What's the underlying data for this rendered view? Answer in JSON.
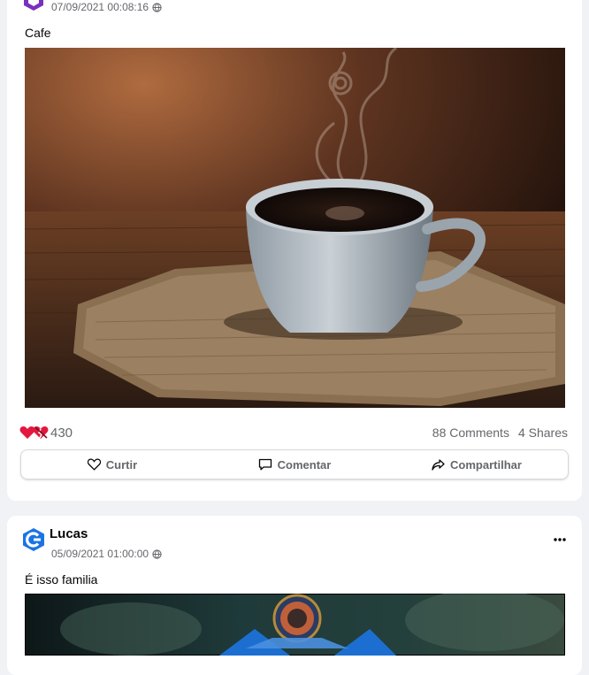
{
  "post1": {
    "timestamp": "07/09/2021 00:08:16",
    "caption": "Cafe",
    "reaction_count": "430",
    "comments": "88 Comments",
    "shares": "4 Shares",
    "actions": {
      "like": "Curtir",
      "comment": "Comentar",
      "share": "Compartilhar"
    }
  },
  "post2": {
    "author": "Lucas",
    "timestamp": "05/09/2021 01:00:00",
    "caption": "É isso familia"
  },
  "colors": {
    "like_red": "#e4173e",
    "muted": "#65676b",
    "brand_blue": "#1b74e4"
  },
  "icons": [
    "globe-icon",
    "heart-icon",
    "broken-heart-icon",
    "comment-icon",
    "share-icon",
    "more-dots-icon",
    "avatar-logo-icon"
  ]
}
